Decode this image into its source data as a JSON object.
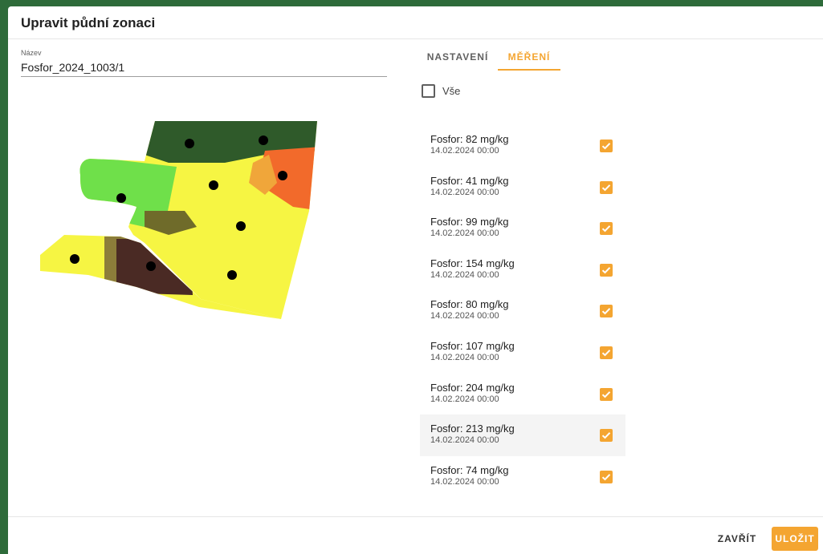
{
  "dialog": {
    "title": "Upravit půdní zonaci"
  },
  "name_field": {
    "label": "Název",
    "value": "Fosfor_2024_1003/1"
  },
  "tabs": [
    {
      "label": "NASTAVENÍ",
      "active": false
    },
    {
      "label": "MĚŘENÍ",
      "active": true
    }
  ],
  "select_all": {
    "label": "Vše",
    "checked": false
  },
  "measurements": [
    {
      "title": "Fosfor: 82 mg/kg",
      "date": "14.02.2024 00:00",
      "checked": true
    },
    {
      "title": "Fosfor: 41 mg/kg",
      "date": "14.02.2024 00:00",
      "checked": true
    },
    {
      "title": "Fosfor: 99 mg/kg",
      "date": "14.02.2024 00:00",
      "checked": true
    },
    {
      "title": "Fosfor: 154 mg/kg",
      "date": "14.02.2024 00:00",
      "checked": true
    },
    {
      "title": "Fosfor: 80 mg/kg",
      "date": "14.02.2024 00:00",
      "checked": true
    },
    {
      "title": "Fosfor: 107 mg/kg",
      "date": "14.02.2024 00:00",
      "checked": true
    },
    {
      "title": "Fosfor: 204 mg/kg",
      "date": "14.02.2024 00:00",
      "checked": true
    },
    {
      "title": "Fosfor: 213 mg/kg",
      "date": "14.02.2024 00:00",
      "checked": true
    },
    {
      "title": "Fosfor: 74 mg/kg",
      "date": "14.02.2024 00:00",
      "checked": true
    }
  ],
  "footer": {
    "close_label": "ZAVŘÍT",
    "save_label": "ULOŽIT"
  },
  "colors": {
    "accent": "#f4a531",
    "background": "#2e6b3a",
    "zone_dark_green": "#2f5a2a",
    "zone_light_green": "#6fe04a",
    "zone_yellow": "#f6f543",
    "zone_orange": "#f26a2b",
    "zone_dark_brown": "#4a2a24",
    "zone_olive": "#6f6b2a"
  }
}
